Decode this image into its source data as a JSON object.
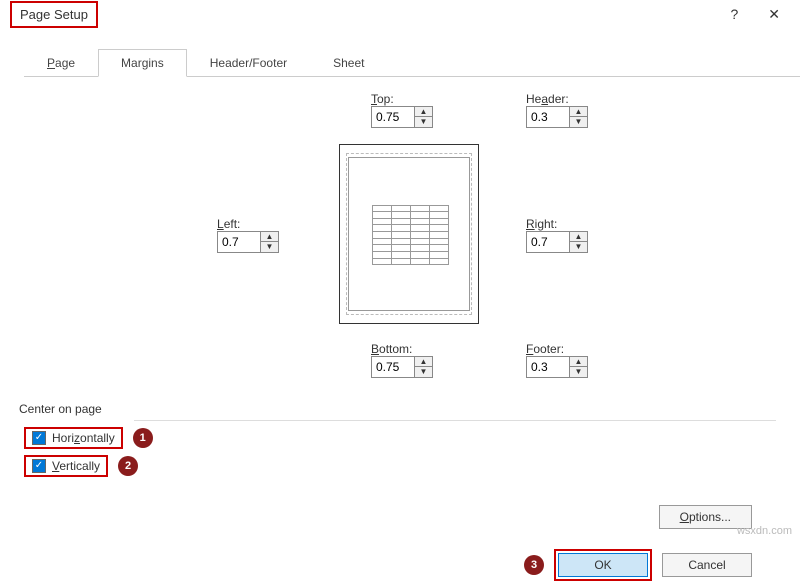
{
  "title": "Page Setup",
  "tabs": {
    "page": "Page",
    "margins": "Margins",
    "header_footer": "Header/Footer",
    "sheet": "Sheet"
  },
  "labels": {
    "top": "Top:",
    "header": "Header:",
    "left": "Left:",
    "right": "Right:",
    "bottom": "Bottom:",
    "footer": "Footer:",
    "center_on_page": "Center on page",
    "horizontally": "Horizontally",
    "vertically": "Vertically"
  },
  "values": {
    "top": "0.75",
    "header": "0.3",
    "left": "0.7",
    "right": "0.7",
    "bottom": "0.75",
    "footer": "0.3"
  },
  "buttons": {
    "options": "Options...",
    "ok": "OK",
    "cancel": "Cancel"
  },
  "system": {
    "help": "?",
    "close": "✕"
  },
  "annotations": {
    "badge1": "1",
    "badge2": "2",
    "badge3": "3"
  },
  "watermark": "wsxdn.com"
}
